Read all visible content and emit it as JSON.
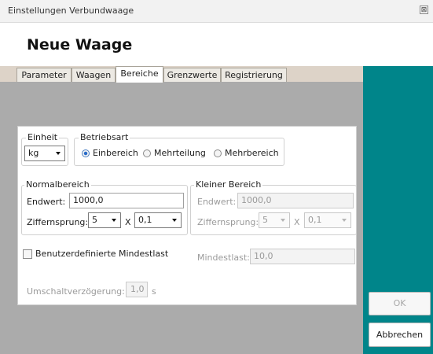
{
  "window": {
    "title": "Einstellungen Verbundwaage",
    "close_glyph": "⊠"
  },
  "heading": "Neue Waage",
  "tabs": [
    {
      "label": "Parameter"
    },
    {
      "label": "Waagen"
    },
    {
      "label": "Bereiche",
      "active": true
    },
    {
      "label": "Grenzwerte"
    },
    {
      "label": "Registrierung"
    }
  ],
  "einheit": {
    "legend": "Einheit",
    "value": "kg"
  },
  "betriebsart": {
    "legend": "Betriebsart",
    "options": [
      {
        "label": "Einbereich",
        "checked": true
      },
      {
        "label": "Mehrteilung",
        "checked": false
      },
      {
        "label": "Mehrbereich",
        "checked": false
      }
    ]
  },
  "normalbereich": {
    "legend": "Normalbereich",
    "endwert_label": "Endwert:",
    "endwert_value": "1000,0",
    "ziffernsprung_label": "Ziffernsprung:",
    "ziffernsprung_value": "5",
    "x_label": "X",
    "factor_value": "0,1"
  },
  "kleiner_bereich": {
    "legend": "Kleiner Bereich",
    "endwert_label": "Endwert:",
    "endwert_value": "1000,0",
    "ziffernsprung_label": "Ziffernsprung:",
    "ziffernsprung_value": "5",
    "x_label": "X",
    "factor_value": "0,1",
    "disabled": true
  },
  "mindestlast": {
    "checkbox_label": "Benutzerdefinierte Mindestlast",
    "checked": false,
    "label": "Mindestlast:",
    "value": "10,0"
  },
  "umschalt": {
    "label": "Umschaltverzögerung:",
    "value": "1,0",
    "unit": "s"
  },
  "buttons": {
    "ok": "OK",
    "cancel": "Abbrechen"
  },
  "colors": {
    "accent_teal": "#00858a",
    "tab_strip": "#ddd3c8",
    "grey_area": "#ababab"
  }
}
